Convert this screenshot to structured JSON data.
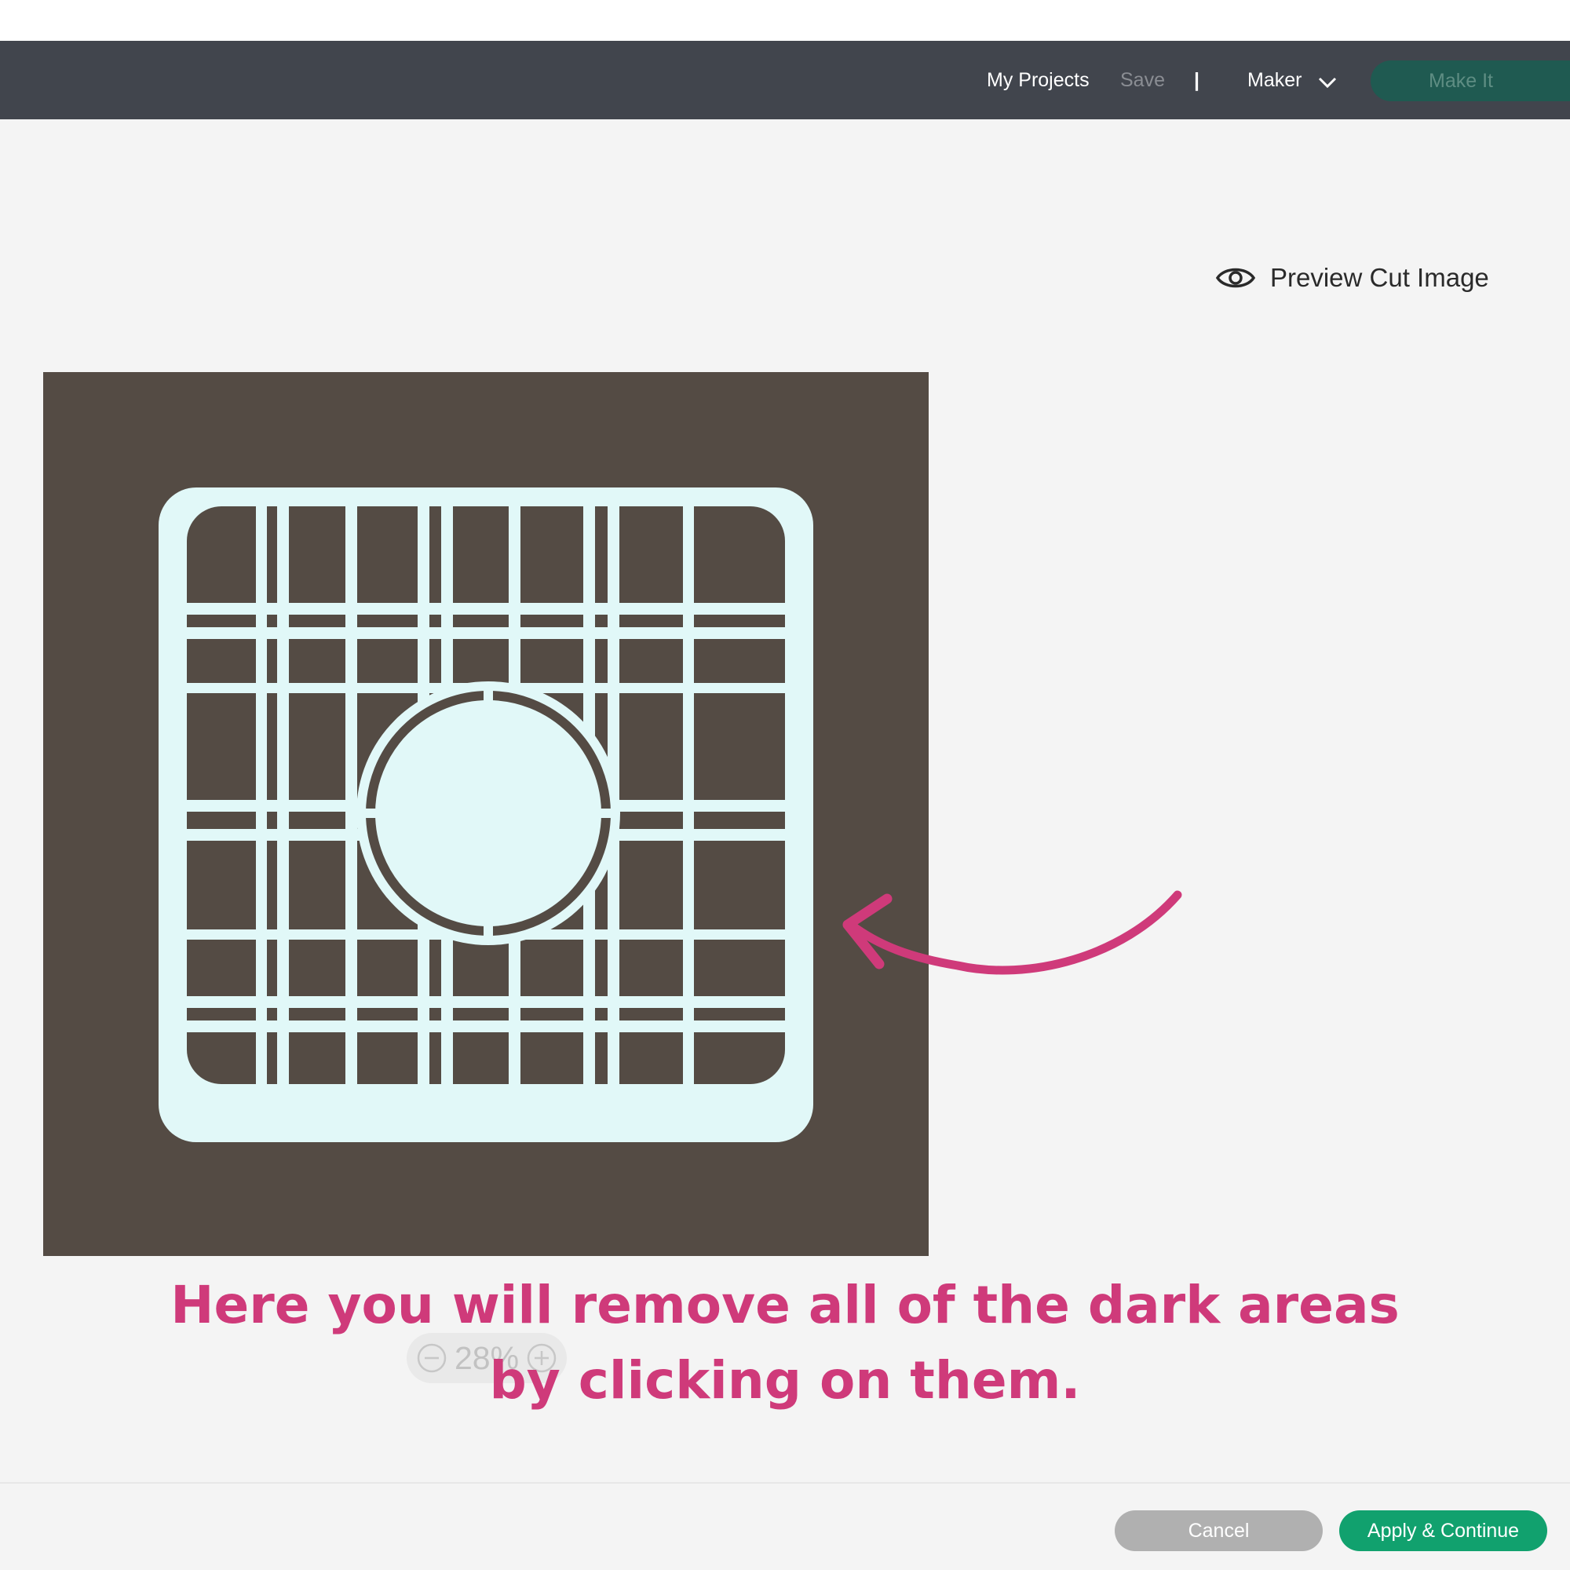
{
  "header": {
    "my_projects": "My Projects",
    "save": "Save",
    "separator": "|",
    "machine": "Maker",
    "make_it": "Make It"
  },
  "preview": {
    "label": "Preview Cut Image",
    "icon": "eye-icon"
  },
  "zoom": {
    "value": "28%"
  },
  "annotation": {
    "line1": "Here you will remove all of the dark areas",
    "line2": "by clicking on them."
  },
  "footer": {
    "cancel": "Cancel",
    "apply": "Apply & Continue"
  },
  "colors": {
    "header_bg": "#41454d",
    "accent_green": "#11a16e",
    "annotation_pink": "#cf3a7a",
    "image_dark": "#544b44",
    "image_light": "#e1f8f8"
  }
}
